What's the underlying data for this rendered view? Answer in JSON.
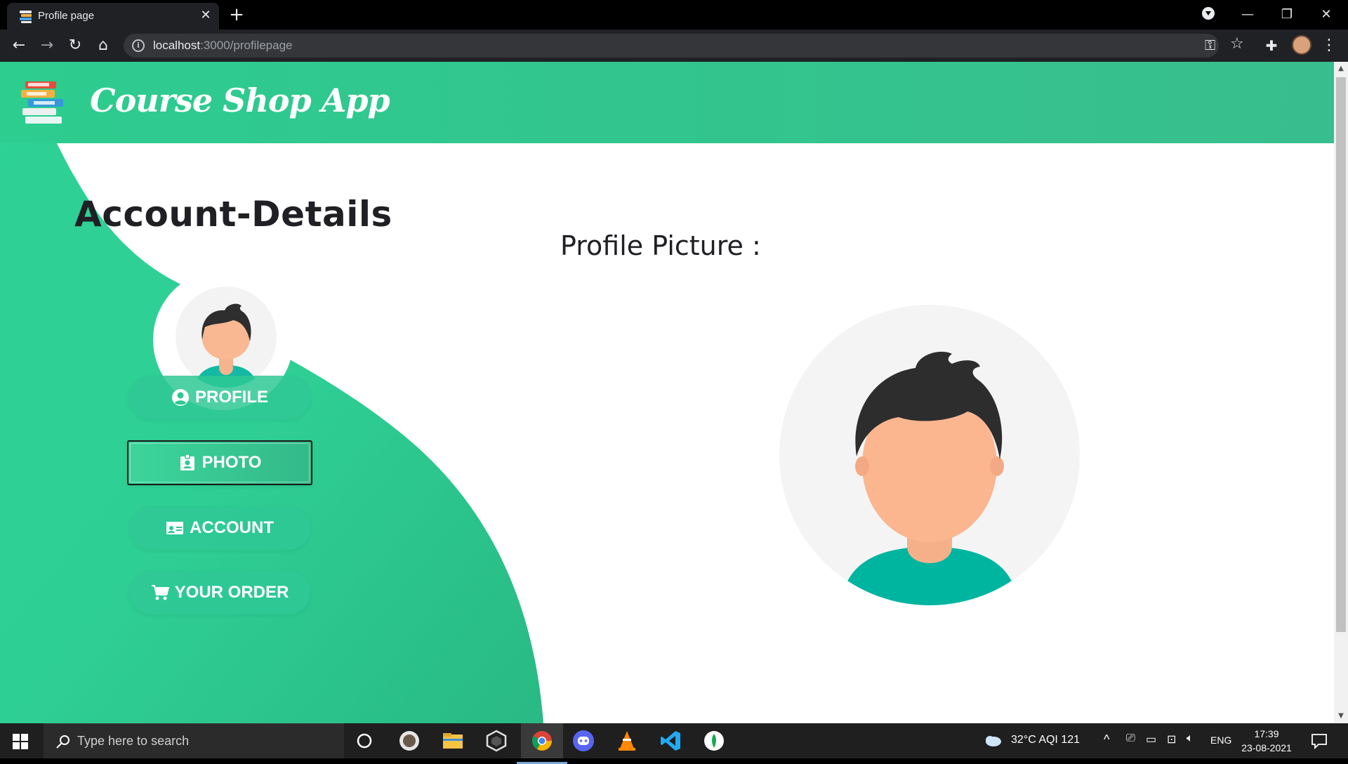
{
  "browser": {
    "tab_title": "Profile page",
    "new_tab_symbol": "+",
    "url_host": "localhost",
    "url_path": ":3000/profilepage",
    "window_controls": [
      "—",
      "❐",
      "✕"
    ]
  },
  "app": {
    "brand": "Course Shop App",
    "heading": "Account-Details",
    "profile_picture_label": "Profile Picture :",
    "menu": [
      {
        "label": "PROFILE",
        "icon": "user-circle-icon",
        "active": false
      },
      {
        "label": "PHOTO",
        "icon": "id-badge-icon",
        "active": true
      },
      {
        "label": "ACCOUNT",
        "icon": "id-card-icon",
        "active": false
      },
      {
        "label": "YOUR ORDER",
        "icon": "cart-icon",
        "active": false
      }
    ],
    "colors": {
      "primary": "#2dcc8f",
      "dark_text": "#1f1f24"
    }
  },
  "taskbar": {
    "search_placeholder": "Type here to search",
    "weather": "32°C  AQI 121",
    "language": "ENG",
    "time": "17:39",
    "date": "23-08-2021"
  }
}
